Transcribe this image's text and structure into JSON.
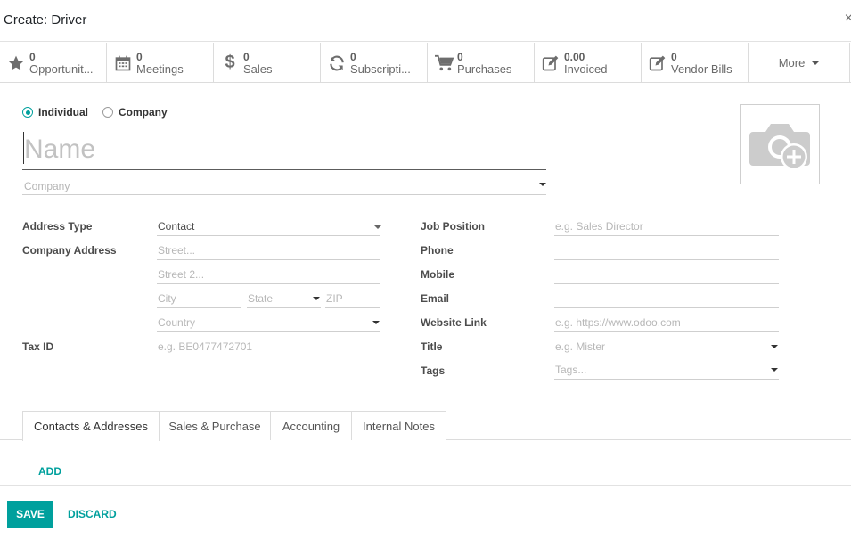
{
  "modal": {
    "title": "Create: Driver",
    "close": "×"
  },
  "stats": [
    {
      "icon": "star-icon",
      "value": "0",
      "label": "Opportunit..."
    },
    {
      "icon": "calendar-icon",
      "value": "0",
      "label": "Meetings"
    },
    {
      "icon": "dollar-icon",
      "value": "0",
      "label": "Sales"
    },
    {
      "icon": "refresh-icon",
      "value": "0",
      "label": "Subscripti..."
    },
    {
      "icon": "cart-icon",
      "value": "0",
      "label": "Purchases"
    },
    {
      "icon": "edit-icon",
      "value": "0.00",
      "label": "Invoiced"
    },
    {
      "icon": "edit-icon",
      "value": "0",
      "label": "Vendor Bills"
    }
  ],
  "more_label": "More",
  "partner_type": {
    "individual": "Individual",
    "company": "Company",
    "selected": "individual"
  },
  "name_placeholder": "Name",
  "company_placeholder": "Company",
  "left_fields": {
    "address_type_label": "Address Type",
    "address_type_value": "Contact",
    "company_address_label": "Company Address",
    "street_placeholder": "Street...",
    "street2_placeholder": "Street 2...",
    "city_placeholder": "City",
    "state_placeholder": "State",
    "zip_placeholder": "ZIP",
    "country_placeholder": "Country",
    "tax_id_label": "Tax ID",
    "tax_id_placeholder": "e.g. BE0477472701"
  },
  "right_fields": {
    "job_position_label": "Job Position",
    "job_position_placeholder": "e.g. Sales Director",
    "phone_label": "Phone",
    "mobile_label": "Mobile",
    "email_label": "Email",
    "website_label": "Website Link",
    "website_placeholder": "e.g. https://www.odoo.com",
    "title_label": "Title",
    "title_placeholder": "e.g. Mister",
    "tags_label": "Tags",
    "tags_placeholder": "Tags..."
  },
  "tabs": [
    "Contacts & Addresses",
    "Sales & Purchase",
    "Accounting",
    "Internal Notes"
  ],
  "add_label": "ADD",
  "footer": {
    "save": "SAVE",
    "discard": "DISCARD"
  },
  "colors": {
    "accent": "#00a09d"
  }
}
